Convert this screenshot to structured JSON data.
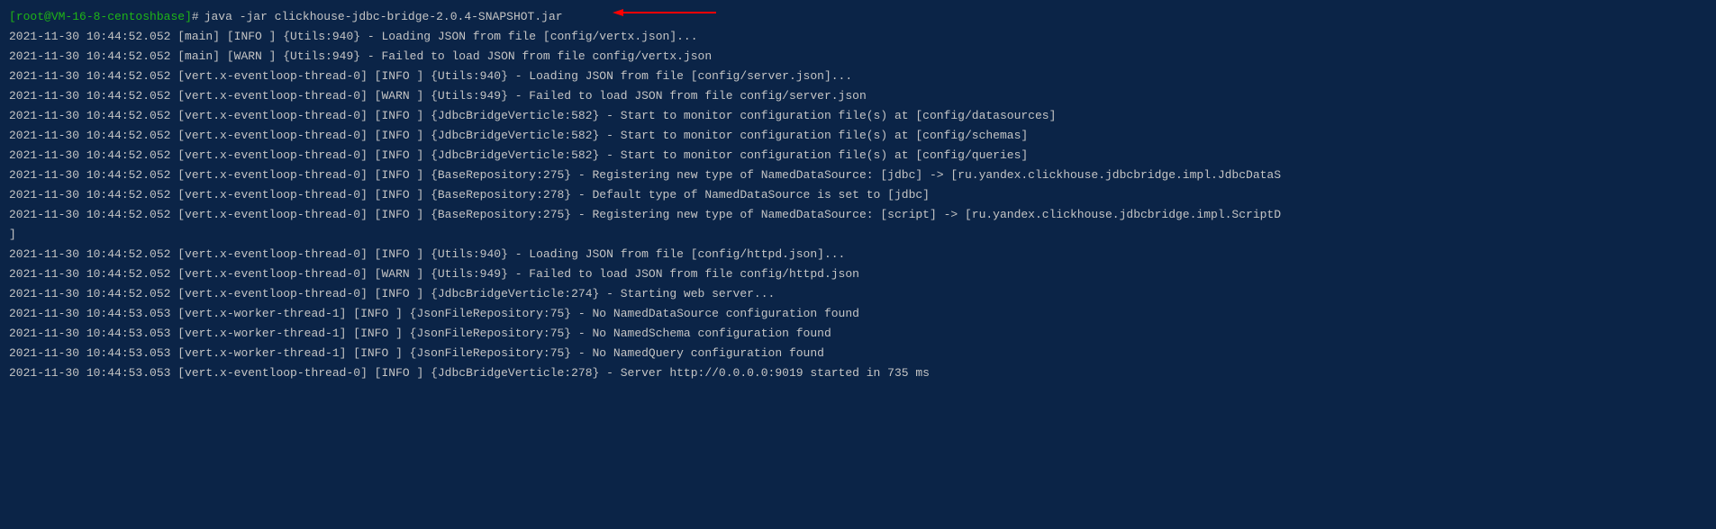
{
  "prompt": {
    "open_bracket": "[",
    "user_host": "root@VM-16-8-centos",
    "space": " ",
    "cwd": "hbase",
    "close_bracket": "]",
    "hash": "#",
    "command": "java -jar clickhouse-jdbc-bridge-2.0.4-SNAPSHOT.jar"
  },
  "logs": [
    "2021-11-30 10:44:52.052 [main] [INFO ] {Utils:940} - Loading JSON from file [config/vertx.json]...",
    "2021-11-30 10:44:52.052 [main] [WARN ] {Utils:949} - Failed to load JSON from file config/vertx.json",
    "2021-11-30 10:44:52.052 [vert.x-eventloop-thread-0] [INFO ] {Utils:940} - Loading JSON from file [config/server.json]...",
    "2021-11-30 10:44:52.052 [vert.x-eventloop-thread-0] [WARN ] {Utils:949} - Failed to load JSON from file config/server.json",
    "2021-11-30 10:44:52.052 [vert.x-eventloop-thread-0] [INFO ] {JdbcBridgeVerticle:582} - Start to monitor configuration file(s) at [config/datasources]",
    "2021-11-30 10:44:52.052 [vert.x-eventloop-thread-0] [INFO ] {JdbcBridgeVerticle:582} - Start to monitor configuration file(s) at [config/schemas]",
    "2021-11-30 10:44:52.052 [vert.x-eventloop-thread-0] [INFO ] {JdbcBridgeVerticle:582} - Start to monitor configuration file(s) at [config/queries]",
    "2021-11-30 10:44:52.052 [vert.x-eventloop-thread-0] [INFO ] {BaseRepository:275} - Registering new type of NamedDataSource: [jdbc] -> [ru.yandex.clickhouse.jdbcbridge.impl.JdbcDataS",
    "2021-11-30 10:44:52.052 [vert.x-eventloop-thread-0] [INFO ] {BaseRepository:278} - Default type of NamedDataSource is set to [jdbc]",
    "2021-11-30 10:44:52.052 [vert.x-eventloop-thread-0] [INFO ] {BaseRepository:275} - Registering new type of NamedDataSource: [script] -> [ru.yandex.clickhouse.jdbcbridge.impl.ScriptD",
    "]",
    "2021-11-30 10:44:52.052 [vert.x-eventloop-thread-0] [INFO ] {Utils:940} - Loading JSON from file [config/httpd.json]...",
    "2021-11-30 10:44:52.052 [vert.x-eventloop-thread-0] [WARN ] {Utils:949} - Failed to load JSON from file config/httpd.json",
    "2021-11-30 10:44:52.052 [vert.x-eventloop-thread-0] [INFO ] {JdbcBridgeVerticle:274} - Starting web server...",
    "2021-11-30 10:44:53.053 [vert.x-worker-thread-1] [INFO ] {JsonFileRepository:75} - No NamedDataSource configuration found",
    "2021-11-30 10:44:53.053 [vert.x-worker-thread-1] [INFO ] {JsonFileRepository:75} - No NamedSchema configuration found",
    "2021-11-30 10:44:53.053 [vert.x-worker-thread-1] [INFO ] {JsonFileRepository:75} - No NamedQuery configuration found",
    "2021-11-30 10:44:53.053 [vert.x-eventloop-thread-0] [INFO ] {JdbcBridgeVerticle:278} - Server http://0.0.0.0:9019 started in 735 ms"
  ],
  "arrow_color": "#ff0000"
}
